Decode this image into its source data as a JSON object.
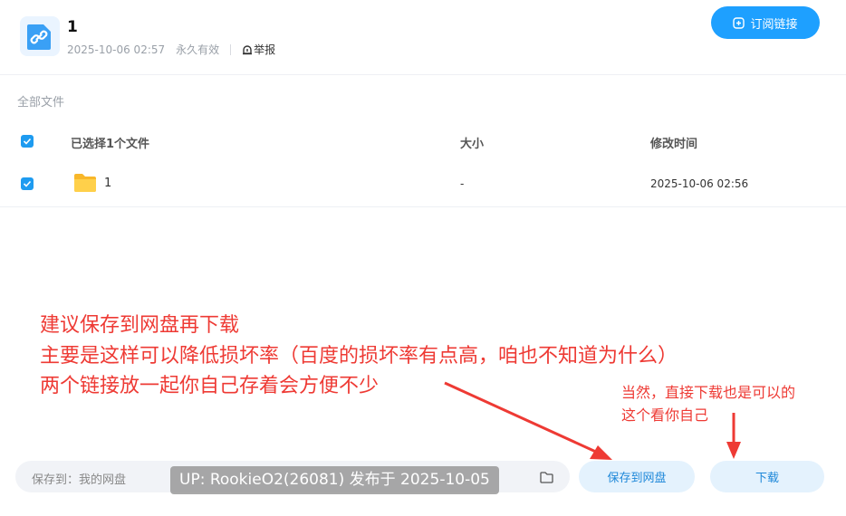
{
  "header": {
    "title": "1",
    "date": "2025-10-06 02:57",
    "validity": "永久有效",
    "report_label": "举报",
    "subscribe_label": "订阅链接"
  },
  "breadcrumb": "全部文件",
  "table": {
    "columns": [
      "已选择1个文件",
      "大小",
      "修改时间"
    ],
    "rows": [
      {
        "name": "1",
        "size": "-",
        "modified": "2025-10-06 02:56",
        "checked": true
      }
    ]
  },
  "annotations": {
    "line1": "建议保存到网盘再下载",
    "line2": "主要是这样可以降低损坏率（百度的损坏率有点高，咱也不知道为什么）",
    "line3": "两个链接放一起你自己存着会方便不少",
    "side1": "当然，直接下载也是可以的",
    "side2": "这个看你自己"
  },
  "footer": {
    "save_path_label": "保存到：我的网盘",
    "watermark": "UP: RookieO2(26081) 发布于 2025-10-05",
    "save_button": "保存到网盘",
    "download_button": "下载"
  },
  "colors": {
    "accent": "#1ea0ff",
    "annotation": "#ee3a34",
    "button_bg": "#e4f2fd"
  }
}
